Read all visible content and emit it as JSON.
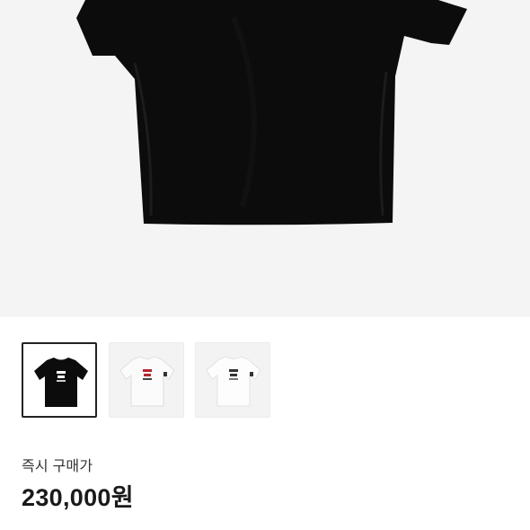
{
  "product": {
    "main_image": "black-tshirt-photo",
    "thumbnails": [
      {
        "name": "black-tshirt-thumbnail",
        "selected": true
      },
      {
        "name": "white-tshirt-red-logo-thumbnail",
        "selected": false
      },
      {
        "name": "white-tshirt-thumbnail",
        "selected": false
      }
    ]
  },
  "price": {
    "label": "즉시 구매가",
    "value": "230,000원"
  },
  "colors": {
    "hero_background": "#f4f4f4",
    "shirt_black": "#0c0c0c",
    "shirt_white": "#fbfbfb",
    "logo_red": "#b5262f"
  }
}
